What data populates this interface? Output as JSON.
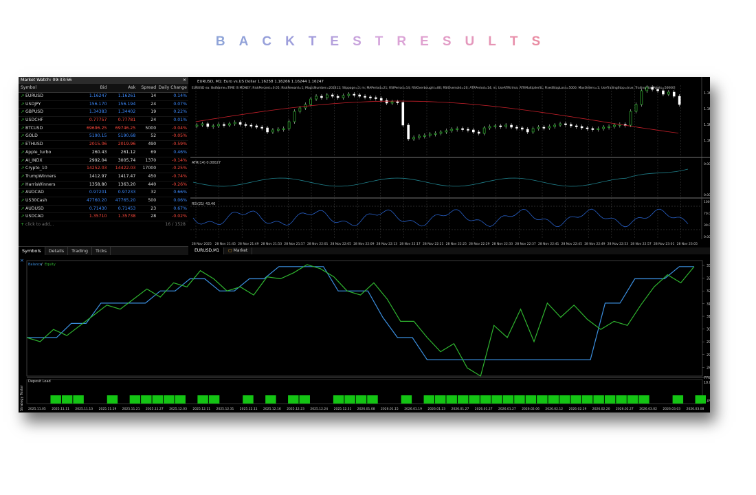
{
  "title": "BACKTESTRESULTS",
  "title_letters": [
    "B",
    "A",
    "C",
    "K",
    "T",
    "E",
    "S",
    "T",
    "R",
    "E",
    "S",
    "U",
    "L",
    "T",
    "S"
  ],
  "title_colors": [
    "#8fa4d8",
    "#92a2d9",
    "#97a0da",
    "#9d9edb",
    "#a29cdc",
    "#b4a0dc",
    "#c8a3dc",
    "#d6a6dc",
    "#dba3d6",
    "#dfa0cf",
    "#e29cc6",
    "#e498bc",
    "#e694b4",
    "#e890ab",
    "#e98ca3"
  ],
  "watermark": "YOFOREX",
  "market_watch": {
    "title": "Market Watch: 09:33:56",
    "close": "×",
    "columns": [
      "Symbol",
      "Bid",
      "Ask",
      "Spread",
      "Daily Change"
    ],
    "rows": [
      {
        "symbol": "EURUSD",
        "bid": "1.16247",
        "ask": "1.16261",
        "spread": "14",
        "change": "0.14%",
        "color": "blue"
      },
      {
        "symbol": "USDJPY",
        "bid": "156.170",
        "ask": "156.194",
        "spread": "24",
        "change": "0.07%",
        "color": "blue"
      },
      {
        "symbol": "GBPUSD",
        "bid": "1.34383",
        "ask": "1.34402",
        "spread": "19",
        "change": "0.22%",
        "color": "blue"
      },
      {
        "symbol": "USDCHF",
        "bid": "0.77757",
        "ask": "0.77781",
        "spread": "24",
        "change": "0.01%",
        "color": "red"
      },
      {
        "symbol": "BTCUSD",
        "bid": "69696.25",
        "ask": "69746.25",
        "spread": "5000",
        "change": "-0.04%",
        "color": "red"
      },
      {
        "symbol": "GOLD",
        "bid": "5190.15",
        "ask": "5190.68",
        "spread": "52",
        "change": "-0.05%",
        "color": "blue"
      },
      {
        "symbol": "ETHUSD",
        "bid": "2015.06",
        "ask": "2019.96",
        "spread": "490",
        "change": "-0.59%",
        "color": "red"
      },
      {
        "symbol": "Apple_turbo",
        "bid": "260.43",
        "ask": "261.12",
        "spread": "69",
        "change": "0.46%",
        "color": "white"
      },
      {
        "symbol": "AI_INDX",
        "bid": "2992.04",
        "ask": "3005.74",
        "spread": "1370",
        "change": "-0.14%",
        "color": "white"
      },
      {
        "symbol": "Crypto_10",
        "bid": "14252.03",
        "ask": "14422.03",
        "spread": "17000",
        "change": "-0.25%",
        "color": "red"
      },
      {
        "symbol": "TrumpWinners",
        "bid": "1412.97",
        "ask": "1417.47",
        "spread": "450",
        "change": "-0.74%",
        "color": "white"
      },
      {
        "symbol": "HarrisWinners",
        "bid": "1358.80",
        "ask": "1363.20",
        "spread": "440",
        "change": "-0.26%",
        "color": "white"
      },
      {
        "symbol": "AUDCAD",
        "bid": "0.97201",
        "ask": "0.97233",
        "spread": "32",
        "change": "0.66%",
        "color": "blue"
      },
      {
        "symbol": "US30Cash",
        "bid": "47760.20",
        "ask": "47765.20",
        "spread": "500",
        "change": "0.06%",
        "color": "blue"
      },
      {
        "symbol": "AUDUSD",
        "bid": "0.71430",
        "ask": "0.71453",
        "spread": "23",
        "change": "0.67%",
        "color": "blue"
      },
      {
        "symbol": "USDCAD",
        "bid": "1.35710",
        "ask": "1.35738",
        "spread": "28",
        "change": "-0.02%",
        "color": "red"
      }
    ],
    "add_label": "click to add...",
    "count": "16 / 1528",
    "tabs": [
      "Symbols",
      "Details",
      "Trading",
      "Ticks"
    ]
  },
  "chart": {
    "header": "EURUSD, M1: Euro vs.US Dollar 1.16258 1.16266 1.16244 1.16247",
    "ea_params": "EURUSD ea: BotName=TIME IS MONEY; RiskPercent=0.05; RiskReward=1; MagicNumber=202412; Slippage=3; m; MAPeriod=21; RSIPeriod=14; RSIOverbought=80; RSIOversold=20; ATRPeriod=14; m; UseATRtrima; ATRMultiplierSL; FixedStopLoss=5000; MaxOrders=1; UseTrailingStop=true; TrailingStopPoints=50000]",
    "price_labels": [
      "1.16530",
      "1.16420",
      "1.16310",
      "1.16200"
    ],
    "atr_label": "ATR(14) 0.00027",
    "atr_scale": [
      "0.00000",
      "0.00000"
    ],
    "rsi_label": "RSI(21) 43.46",
    "rsi_scale": [
      "100.00",
      "70.00",
      "30.00",
      "0.00"
    ],
    "time_labels": [
      "28 Nov 2025",
      "28 Nov 21:45",
      "28 Nov 21:49",
      "28 Nov 21:53",
      "28 Nov 21:57",
      "28 Nov 22:01",
      "28 Nov 22:05",
      "28 Nov 22:09",
      "28 Nov 22:13",
      "28 Nov 22:17",
      "28 Nov 22:21",
      "28 Nov 22:25",
      "28 Nov 22:29",
      "28 Nov 22:33",
      "28 Nov 22:37",
      "28 Nov 22:41",
      "28 Nov 22:45",
      "28 Nov 22:49",
      "28 Nov 22:53",
      "28 Nov 22:57",
      "28 Nov 23:01",
      "28 Nov 23:05"
    ],
    "tabs": [
      "EURUSD,M1",
      "Market"
    ]
  },
  "tester": {
    "close": "×",
    "legend_balance": "Balance",
    "legend_equity": "Equity",
    "legend_sep": " / ",
    "y_labels": [
      "335.6",
      "329.3",
      "323.0",
      "316.7",
      "310.5",
      "304.2",
      "297.9",
      "291.6",
      "285.3"
    ],
    "deposit_label": "Deposit Load",
    "deposit_scale_top": "776.0",
    "deposit_scale_mid": "10.0%",
    "deposit_scale_bot": "0.0%",
    "vertical_label": "Strategy Tester",
    "date_labels": [
      "2025.11.05",
      "2025.11.11",
      "2025.11.13",
      "2025.11.19",
      "2025.11.21",
      "2025.11.27",
      "2025.12.03",
      "2025.12.11",
      "2025.12.31",
      "2025.12.11",
      "2025.12.16",
      "2025.12.23",
      "2025.12.24",
      "2025.12.31",
      "2026.01.08",
      "2026.01.15",
      "2026.01.19",
      "2026.01.23",
      "2026.01.27",
      "2026.01.27",
      "2026.01.27",
      "2026.02.06",
      "2026.02.12",
      "2026.02.19",
      "2026.02.20",
      "2026.02.27",
      "2026.03.02",
      "2026.03.03",
      "2026.03.08"
    ],
    "colors": {
      "balance": "#3b8fe0",
      "equity": "#2fb52f",
      "load": "#14c414"
    }
  },
  "chart_data": {
    "type": "line",
    "y_range": [
      281.0,
      338.0
    ],
    "series": [
      {
        "name": "Balance",
        "values": [
          300,
          300,
          300,
          307,
          307,
          317,
          317,
          317,
          317,
          323,
          323,
          329,
          329,
          323,
          323,
          329,
          329,
          335,
          335,
          335,
          335,
          323,
          323,
          323,
          310,
          300,
          300,
          289,
          289,
          289,
          289,
          289,
          289,
          289,
          289,
          289,
          289,
          289,
          289,
          317,
          317,
          329,
          329,
          329,
          335,
          335
        ]
      },
      {
        "name": "Equity",
        "values": [
          300,
          298,
          304,
          301,
          306,
          311,
          316,
          314,
          319,
          324,
          320,
          327,
          325,
          333,
          329,
          323,
          325,
          321,
          330,
          329,
          332,
          336,
          334,
          330,
          323,
          321,
          327,
          319,
          308,
          308,
          300,
          293,
          297,
          285,
          281,
          306,
          300,
          314,
          298,
          317,
          310,
          316,
          309,
          304,
          308,
          306,
          316,
          325,
          331,
          327,
          335
        ]
      }
    ],
    "deposit_load": [
      0,
      1,
      1,
      1,
      0,
      0,
      1,
      0,
      1,
      1,
      1,
      1,
      1,
      0,
      1,
      1,
      0,
      0,
      1,
      0,
      1,
      0,
      1,
      1,
      0,
      0,
      1,
      1,
      1,
      1,
      0,
      0,
      1,
      0,
      1,
      1,
      1,
      1,
      1,
      1,
      1,
      1,
      1,
      1,
      1,
      1,
      1,
      1,
      1,
      1,
      1,
      1,
      1,
      1,
      0,
      0,
      1,
      0,
      1
    ]
  }
}
